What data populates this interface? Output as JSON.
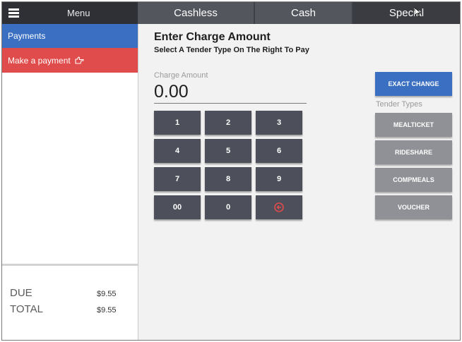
{
  "header": {
    "menu_label": "Menu",
    "tabs": [
      {
        "label": "Cashless"
      },
      {
        "label": "Cash"
      },
      {
        "label": "Special"
      }
    ]
  },
  "sidebar": {
    "items": [
      {
        "label": "Payments"
      },
      {
        "label": "Make a payment"
      }
    ],
    "totals": {
      "due_label": "DUE",
      "due_value": "$9.55",
      "total_label": "TOTAL",
      "total_value": "$9.55"
    }
  },
  "main": {
    "title": "Enter Charge Amount",
    "subtitle": "Select A Tender Type On The Right To Pay",
    "amount_label": "Charge Amount",
    "amount_value": "0.00",
    "keypad": [
      "1",
      "2",
      "3",
      "4",
      "5",
      "6",
      "7",
      "8",
      "9",
      "00",
      "0"
    ],
    "backspace_icon": "backspace-circle-icon",
    "exact_change_label": "EXACT CHANGE",
    "tender_types_label": "Tender Types",
    "tender_buttons": [
      "MEALTICKET",
      "RIDESHARE",
      "COMPMEALS",
      "VOUCHER"
    ]
  },
  "colors": {
    "header": "#3f4148",
    "accent_blue": "#3a6fc2",
    "accent_red": "#e04b4b",
    "key_dark": "#4d505a",
    "tender_grey": "#8f9196"
  }
}
